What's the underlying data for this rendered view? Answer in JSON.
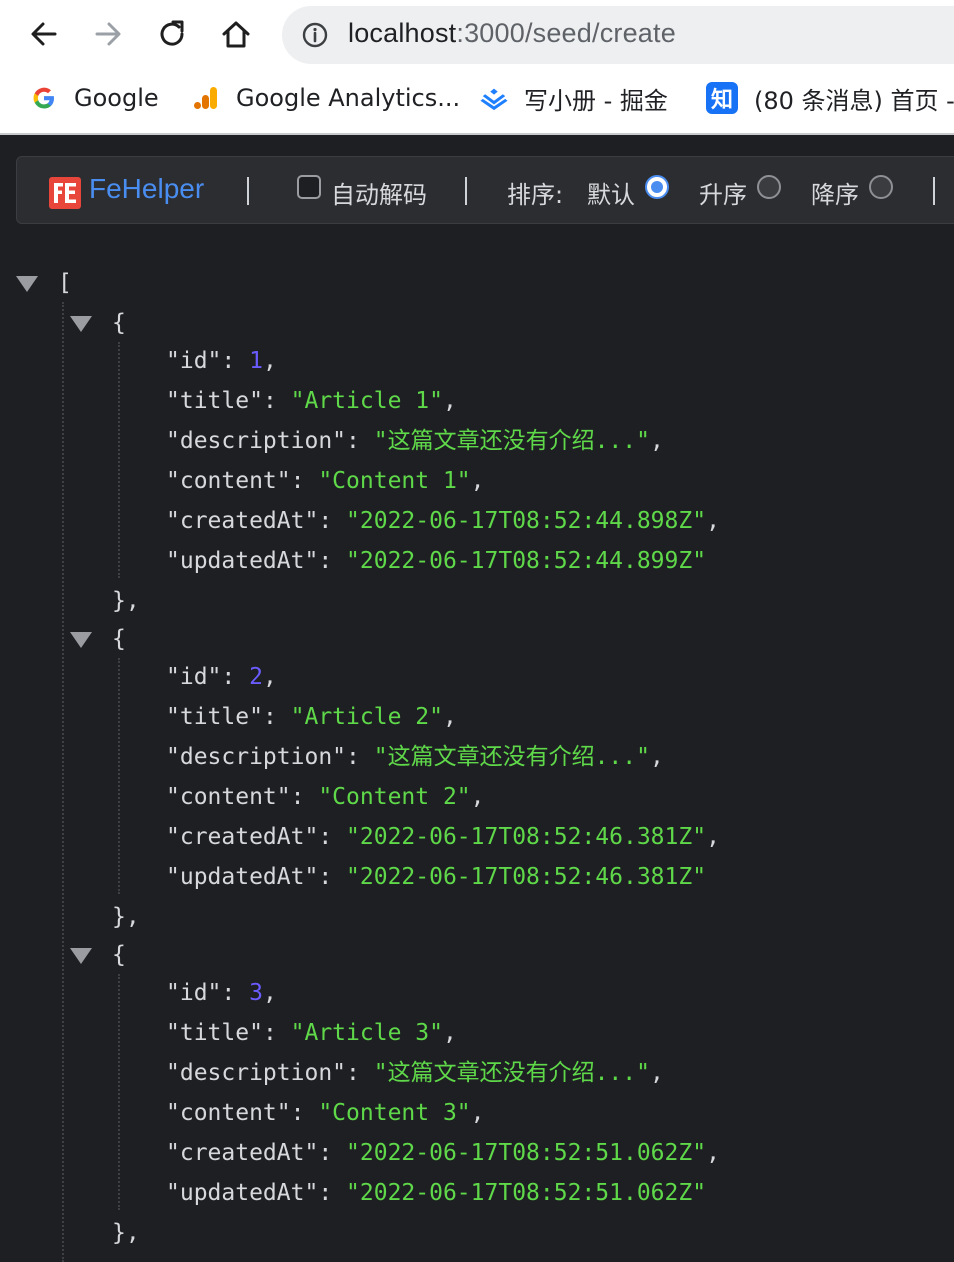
{
  "browser": {
    "url_host": "localhost",
    "url_rest": ":3000/seed/create",
    "bookmarks": [
      {
        "label": "Google",
        "icon": "google-icon"
      },
      {
        "label": "Google Analytics...",
        "icon": "analytics-icon"
      },
      {
        "label": "写小册 - 掘金",
        "icon": "juejin-icon"
      },
      {
        "label": "(80 条消息) 首页 -",
        "icon": "zhihu-icon"
      }
    ]
  },
  "toolbar": {
    "brand": "FeHelper",
    "auto_decode_label": "自动解码",
    "sort_label": "排序:",
    "sort_default": "默认",
    "sort_asc": "升序",
    "sort_desc": "降序",
    "selected_sort": "默认"
  },
  "json": {
    "open_bracket": "[",
    "open_brace": "{",
    "close_brace": "},",
    "key_colon": ": ",
    "items": [
      {
        "id": "1",
        "title": "\"Article 1\"",
        "description": "\"这篇文章还没有介绍...\"",
        "content": "\"Content 1\"",
        "createdAt": "\"2022-06-17T08:52:44.898Z\"",
        "updatedAt": "\"2022-06-17T08:52:44.899Z\""
      },
      {
        "id": "2",
        "title": "\"Article 2\"",
        "description": "\"这篇文章还没有介绍...\"",
        "content": "\"Content 2\"",
        "createdAt": "\"2022-06-17T08:52:46.381Z\"",
        "updatedAt": "\"2022-06-17T08:52:46.381Z\""
      },
      {
        "id": "3",
        "title": "\"Article 3\"",
        "description": "\"这篇文章还没有介绍...\"",
        "content": "\"Content 3\"",
        "createdAt": "\"2022-06-17T08:52:51.062Z\"",
        "updatedAt": "\"2022-06-17T08:52:51.062Z\""
      }
    ],
    "keys": {
      "id": "\"id\"",
      "title": "\"title\"",
      "description": "\"description\"",
      "content": "\"content\"",
      "createdAt": "\"createdAt\"",
      "updatedAt": "\"updatedAt\""
    }
  },
  "colors": {
    "background": "#1e1f22",
    "string": "#5fd84a",
    "number": "#6a5cff",
    "key": "#d6d8dc",
    "brand": "#4a8df0"
  }
}
